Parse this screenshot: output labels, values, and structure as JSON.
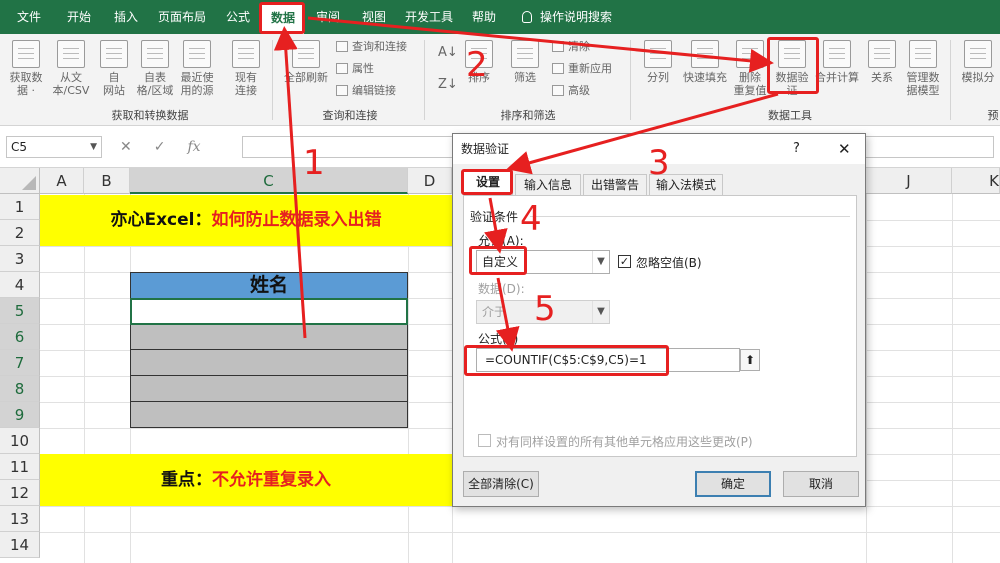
{
  "tabs": [
    "文件",
    "开始",
    "插入",
    "页面布局",
    "公式",
    "数据",
    "审阅",
    "视图",
    "开发工具",
    "帮助"
  ],
  "tell_me": "操作说明搜索",
  "ribbon": {
    "get_data": {
      "btn1": "获取数",
      "btn1b": "据 ·",
      "btn2": "从文",
      "btn2b": "本/CSV",
      "btn3": "自",
      "btn3b": "网站",
      "btn4": "自表",
      "btn4b": "格/区域",
      "btn5": "最近使",
      "btn5b": "用的源",
      "btn6": "现有",
      "btn6b": "连接",
      "group": "获取和转换数据"
    },
    "queries": {
      "refresh": "全部刷新",
      "item1": "查询和连接",
      "item2": "属性",
      "item3": "编辑链接",
      "group": "查询和连接"
    },
    "sort": {
      "sort": "排序",
      "filter": "筛选",
      "clear": "清除",
      "reapply": "重新应用",
      "advanced": "高级",
      "group": "排序和筛选"
    },
    "tools": {
      "split": "分列",
      "flash": "快速填充",
      "dup": "删除",
      "dup2": "重复值",
      "valid": "数据验",
      "valid2": "证",
      "merge": "合并计算",
      "rel": "关系",
      "model": "管理数",
      "model2": "据模型",
      "group": "数据工具",
      "what_if": "模拟分",
      "fore": "预"
    }
  },
  "formula_bar": {
    "name_box": "C5",
    "fx": "fx"
  },
  "sheet": {
    "columns": [
      "A",
      "B",
      "C",
      "D",
      "",
      "",
      "",
      "",
      "J",
      "K"
    ],
    "rows": [
      "1",
      "2",
      "3",
      "4",
      "5",
      "6",
      "7",
      "8",
      "9",
      "10",
      "11",
      "12",
      "13",
      "14"
    ],
    "title_black": "亦心Excel：",
    "title_red": "如何防止数据录入出错",
    "header": "姓名",
    "note_black": "重点：",
    "note_red": "不允许重复录入"
  },
  "dialog": {
    "title": "数据验证",
    "help": "?",
    "close": "✕",
    "tabs": [
      "设置",
      "输入信息",
      "出错警告",
      "输入法模式"
    ],
    "section": "验证条件",
    "allow_label": "允许(A):",
    "allow_value": "自定义",
    "ignore_blank": "忽略空值(B)",
    "data_label": "数据(D):",
    "data_value": "介于",
    "formula_label": "公式(F)",
    "formula_value": "=COUNTIF(C$5:C$9,C5)=1",
    "apply_all": "对有同样设置的所有其他单元格应用这些更改(P)",
    "clear_all": "全部清除(C)",
    "ok": "确定",
    "cancel": "取消"
  },
  "annotations": {
    "step1": "1",
    "step2": "2",
    "step3": "3",
    "step4": "4",
    "step5": "5"
  },
  "colors": {
    "excel_green": "#217346",
    "annotation_red": "#e62020",
    "banner_yellow": "#ffff00",
    "header_blue": "#5b9bd5",
    "cell_gray": "#bfbfbf"
  }
}
